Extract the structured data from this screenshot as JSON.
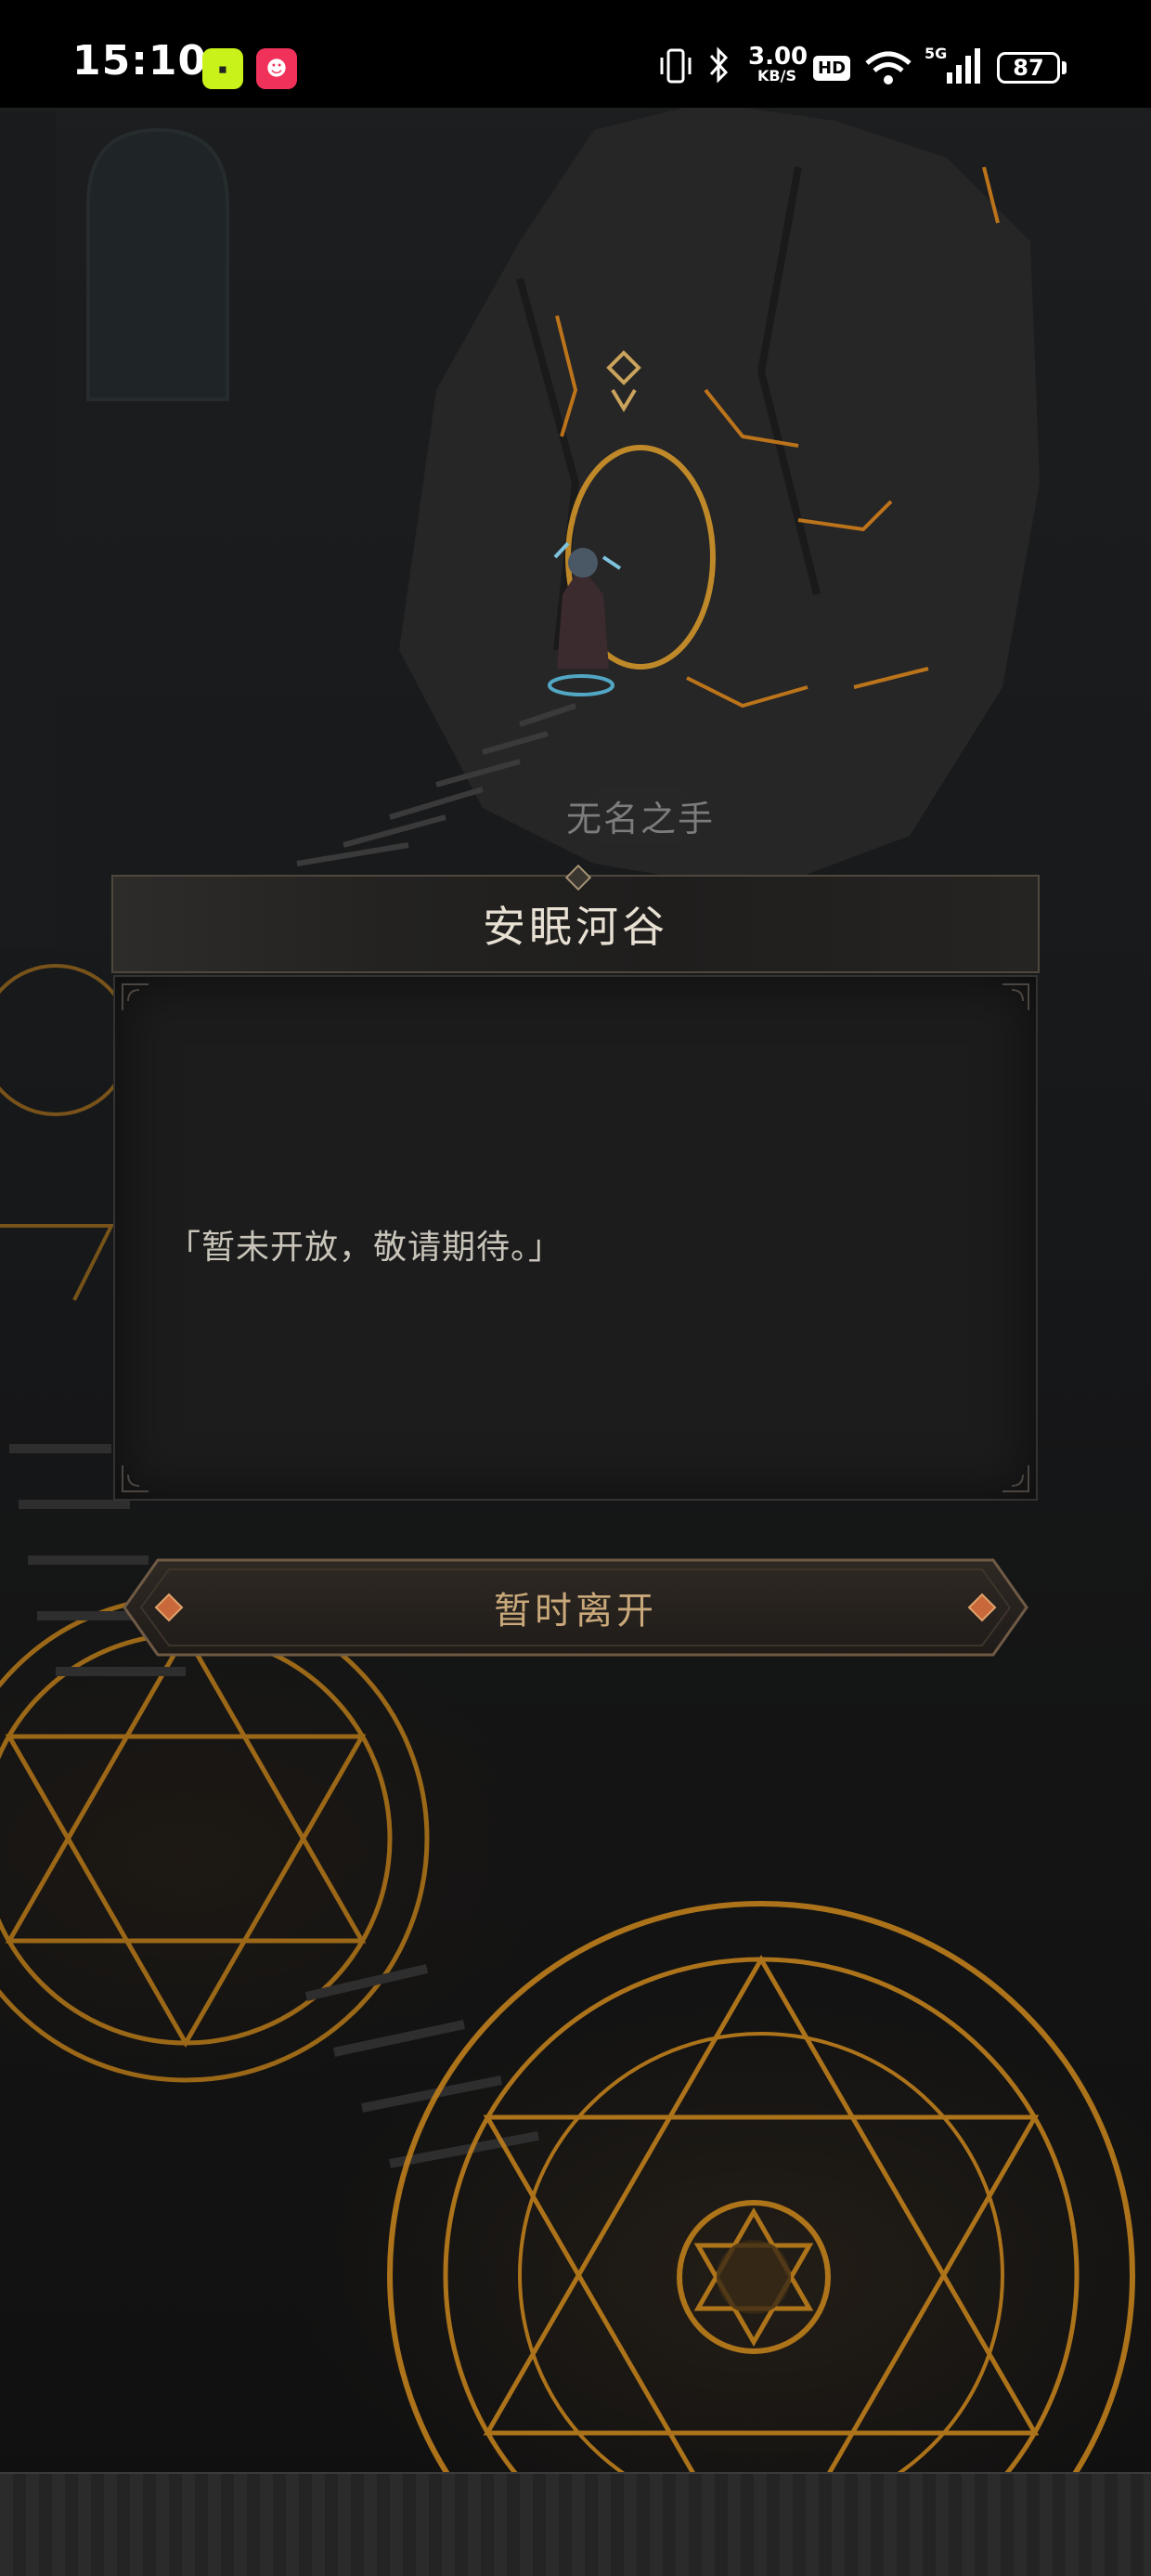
{
  "status_bar": {
    "time": "15:10",
    "app_icons": [
      "app-icon-green",
      "app-icon-red"
    ],
    "net_speed_value": "3.00",
    "net_speed_unit": "KB/S",
    "hd_label": "HD",
    "network_type": "5G",
    "battery": "87"
  },
  "scene": {
    "location_label": "无名之手"
  },
  "dialog": {
    "title": "安眠河谷",
    "message": "「暂未开放，敬请期待。」"
  },
  "actions": {
    "leave_label": "暂时离开"
  },
  "colors": {
    "accent_gold": "#c9a87a",
    "title_text": "#e8e1d3",
    "lava": "#e08a1a"
  }
}
